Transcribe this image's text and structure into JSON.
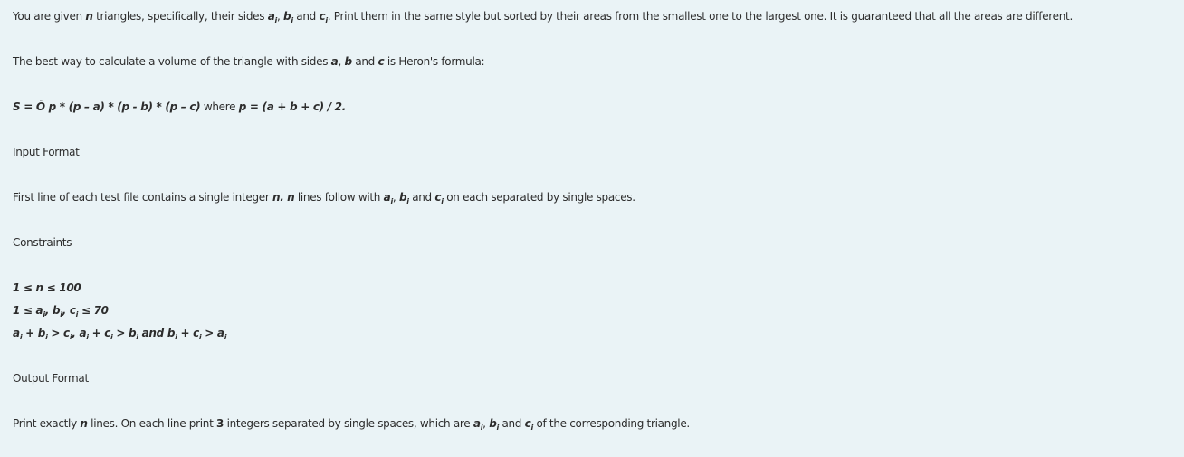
{
  "problem": {
    "intro": {
      "t1": "You are given ",
      "n": "n",
      "t2": " triangles, specifically, their sides ",
      "a": "a",
      "sub_i1": "i",
      "sep1": ", ",
      "b": "b",
      "sub_i2": "i",
      "and": " and ",
      "c": "c",
      "sub_i3": "i",
      "t3": ". Print them in the same style but sorted by their areas from the smallest one to the largest one. It is guaranteed that all the areas are different."
    },
    "heron": {
      "t1": "The best way to calculate a volume of the triangle with sides ",
      "a": "a",
      "sep": ", ",
      "b": "b",
      "and": " and ",
      "c": "c",
      "t2": " is Heron's formula:"
    },
    "formula": {
      "main": "S = Ö p * (p – a) * (p - b) * (p – c)",
      "where": " where ",
      "p_def": "p = (a + b + c) / 2."
    },
    "input_heading": "Input Format",
    "input": {
      "t1": "First line of each test file contains a single integer ",
      "n1": "n.",
      "sp": " ",
      "n2": "n",
      "t2": " lines follow with ",
      "a": "a",
      "sub_i1": "i",
      "sep": ", ",
      "b": "b",
      "sub_i2": "i",
      "and": " and ",
      "c": "c",
      "sub_i3": "i",
      "t3": " on each separated by single spaces."
    },
    "constraints_heading": "Constraints",
    "constraints": {
      "c1": "1 ≤ n ≤ 100",
      "c2": {
        "t1": "1 ≤ a",
        "sub1": "i",
        "t2": ", b",
        "sub2": "i",
        "t3": ", c",
        "sub3": "i",
        "t4": " ≤ 70"
      },
      "c3": {
        "t1": "a",
        "s1": "i",
        "t2": " + b",
        "s2": "i",
        "t3": " > c",
        "s3": "i",
        "t4": ", a",
        "s4": "i",
        "t5": " + c",
        "s5": "i",
        "t6": " > b",
        "s6": "i",
        "t7": " and b",
        "s7": "i",
        "t8": " + c",
        "s8": "i",
        "t9": " > a",
        "s9": "i"
      }
    },
    "output_heading": "Output Format",
    "output": {
      "t1": "Print exactly ",
      "n": "n",
      "t2": " lines. On each line print ",
      "three": "3",
      "t3": " integers separated by single spaces, which are ",
      "a": "a",
      "sub_i1": "i",
      "sep": ", ",
      "b": "b",
      "sub_i2": "i",
      "and": " and ",
      "c": "c",
      "sub_i3": "i",
      "t4": " of the corresponding triangle."
    }
  }
}
